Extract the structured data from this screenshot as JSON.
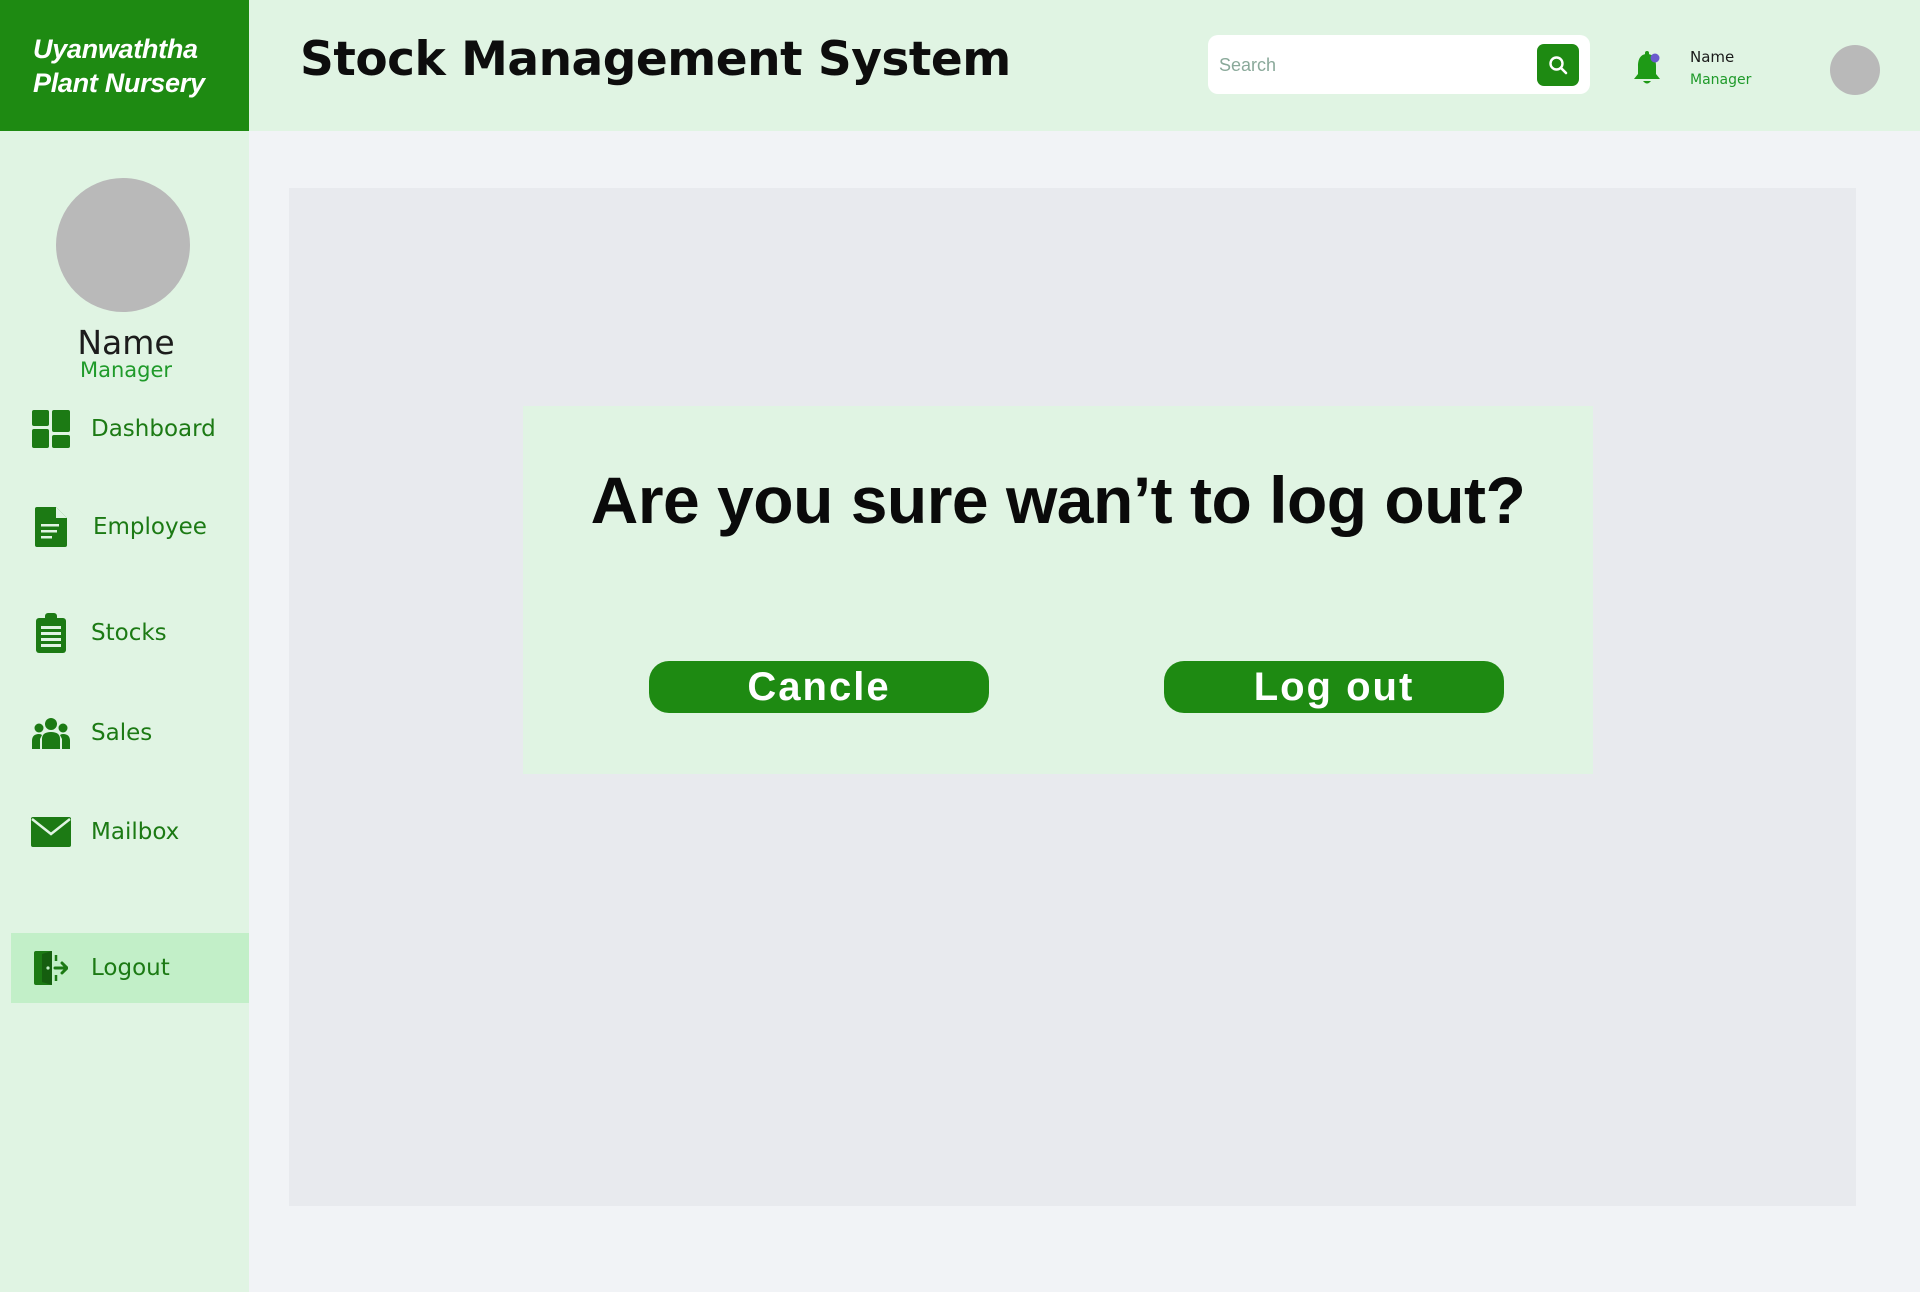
{
  "brand": {
    "line1": "Uyanwaththa",
    "line2": "Plant Nursery"
  },
  "header": {
    "title": "Stock Management System",
    "search_placeholder": "Search",
    "user_name": "Name",
    "user_role": "Manager",
    "icons": {
      "search": "search-icon",
      "notifications": "bell-icon"
    }
  },
  "sidebar": {
    "profile": {
      "name": "Name",
      "role": "Manager"
    },
    "items": [
      {
        "label": "Dashboard",
        "icon": "dashboard-icon"
      },
      {
        "label": "Employee",
        "icon": "document-icon"
      },
      {
        "label": "Stocks",
        "icon": "clipboard-icon"
      },
      {
        "label": "Sales",
        "icon": "people-icon"
      },
      {
        "label": "Mailbox",
        "icon": "mail-icon"
      },
      {
        "label": "Logout",
        "icon": "logout-icon",
        "active": true
      }
    ]
  },
  "dialog": {
    "message": "Are you sure wan’t to log out?",
    "cancel_label": "Cancle",
    "logout_label": "Log out"
  },
  "colors": {
    "brand_green": "#1e8a12",
    "header_bg": "#e0f4e3",
    "active_item_bg": "#c2efc8",
    "role_green": "#1f9a2a",
    "notification_dot": "#6a5acd"
  }
}
